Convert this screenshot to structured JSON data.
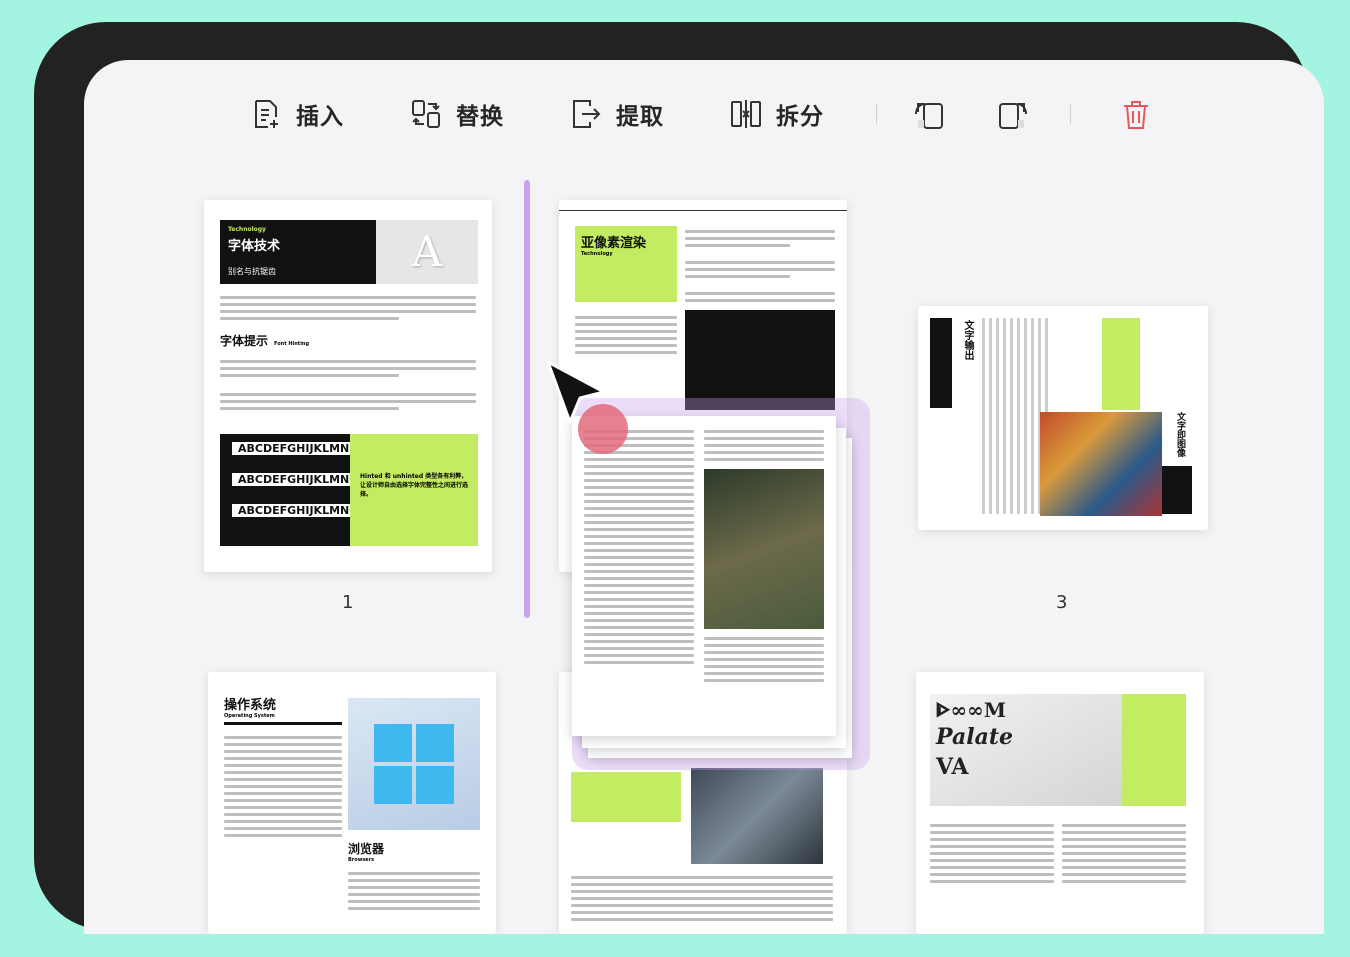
{
  "toolbar": {
    "insert_label": "插入",
    "replace_label": "替换",
    "extract_label": "提取",
    "split_label": "拆分",
    "accent_delete": "#e8585e"
  },
  "pages": {
    "p1": {
      "number": "1",
      "kicker": "Technology",
      "title": "字体技术",
      "subtitle": "别名与抗锯齿",
      "section": "字体提示",
      "section_en": "Font Hinting",
      "sample": "ABCDEFGHIJKLMNO",
      "callout": "Hinted 和 unhinted 类型各有利弊，让设计师自由选择字体完整性之间进行选择。"
    },
    "p2": {
      "title": "亚像素渲染",
      "kicker": "Technology"
    },
    "p3": {
      "number": "3",
      "title_a": "文字输出",
      "title_b": "文字即图像"
    },
    "p4": {
      "title": "操作系统",
      "kicker": "Operating System",
      "section": "浏览器",
      "section_en": "Browsers"
    }
  },
  "colors": {
    "lime": "#c4ec62",
    "drop_indicator": "#c8a4ee"
  }
}
